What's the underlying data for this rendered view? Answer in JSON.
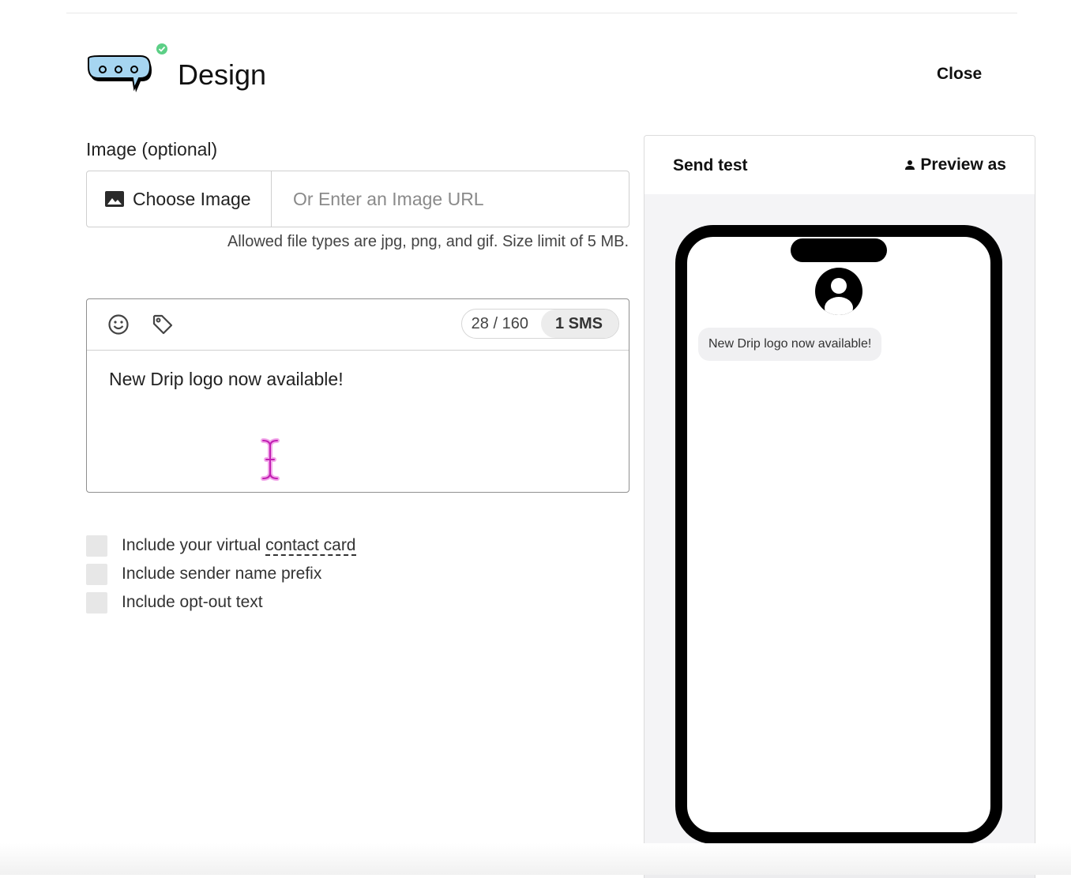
{
  "header": {
    "title": "Design",
    "close_label": "Close"
  },
  "image_section": {
    "label": "Image (optional)",
    "choose_label": "Choose Image",
    "url_placeholder": "Or Enter an Image URL",
    "url_value": "",
    "hint": "Allowed file types are jpg, png, and gif. Size limit of 5 MB."
  },
  "composer": {
    "char_count": "28 / 160",
    "sms_count": "1 SMS",
    "message": "New Drip logo now available!"
  },
  "options": {
    "contact_card_prefix": "Include your virtual ",
    "contact_card_link": "contact card",
    "sender_prefix": "Include sender name prefix",
    "opt_out": "Include opt-out text"
  },
  "preview": {
    "send_test_label": "Send test",
    "preview_as_label": "Preview as",
    "bubble_text": "New Drip logo now available!"
  },
  "colors": {
    "logo_bubble": "#9fd3f2",
    "status_dot": "#4fc97a",
    "cursor": "#e43bd3"
  },
  "icons": [
    "chat-bubble-logo-icon",
    "check-badge-icon",
    "image-icon",
    "emoji-icon",
    "tag-icon",
    "person-icon",
    "avatar-icon",
    "text-cursor-icon"
  ]
}
